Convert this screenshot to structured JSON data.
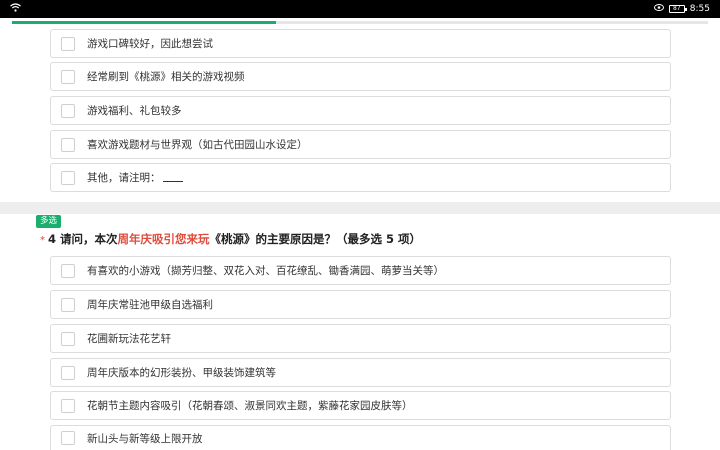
{
  "status_bar": {
    "wifi_icon": "wifi-icon",
    "eye_icon": "eye-icon",
    "battery_level": "87",
    "time": "8:55"
  },
  "progress": {
    "fraction": 0.38,
    "color": "#1aad6c"
  },
  "prev_question": {
    "options": [
      {
        "label": "游戏口碑较好，因此想尝试"
      },
      {
        "label": "经常刷到《桃源》相关的游戏视频"
      },
      {
        "label": "游戏福利、礼包较多"
      },
      {
        "label": "喜欢游戏题材与世界观（如古代田园山水设定）"
      },
      {
        "label": "其他，请注明："
      }
    ]
  },
  "question4": {
    "badge": "多选",
    "required_mark": "*",
    "number": "4",
    "text_before": "请问，本次",
    "text_highlight": "周年庆吸引您来玩",
    "text_after": "《桃源》的主要原因是？（最多选 5 项）",
    "highlight_color": "#e24b3b",
    "options": [
      {
        "label": "有喜欢的小游戏（撷芳归整、双花入对、百花缭乱、锄香满园、萌萝当关等）"
      },
      {
        "label": "周年庆常驻池甲级自选福利"
      },
      {
        "label": "花圃新玩法花艺轩"
      },
      {
        "label": "周年庆版本的幻形装扮、甲级装饰建筑等"
      },
      {
        "label": "花朝节主题内容吸引（花朝春颂、淑景同欢主题，紫藤花家园皮肤等）"
      },
      {
        "label": "新山头与新等级上限开放"
      }
    ]
  }
}
